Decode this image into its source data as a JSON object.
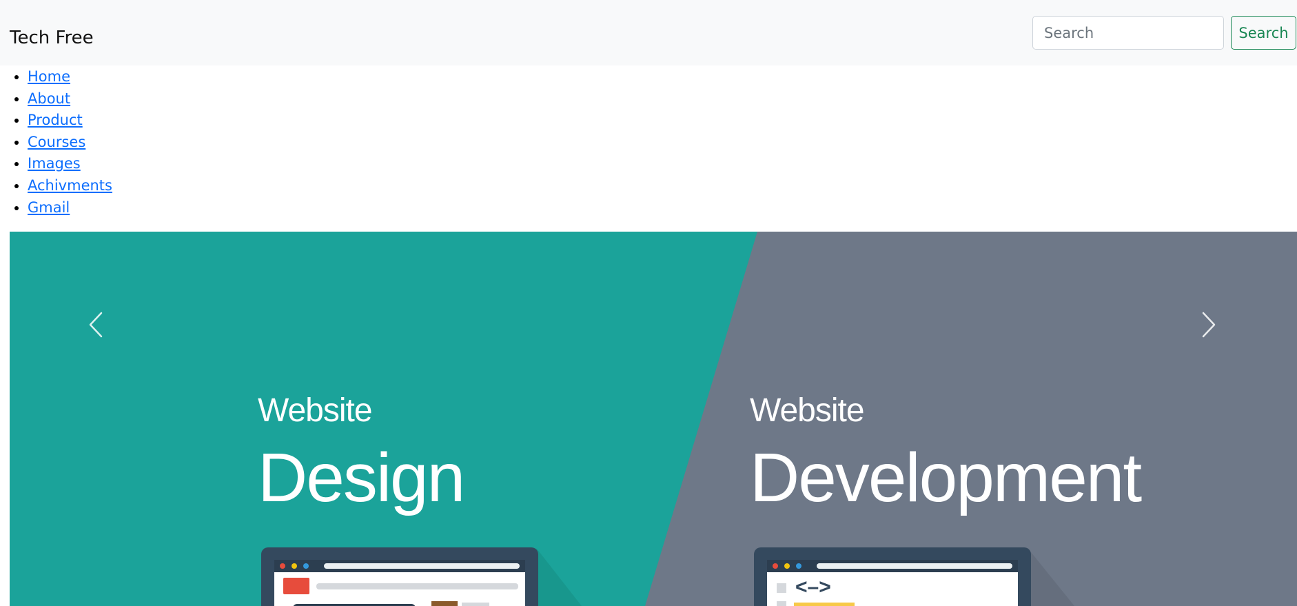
{
  "navbar": {
    "brand": "Tech Free",
    "search_placeholder": "Search",
    "search_button_label": "Search"
  },
  "nav_links": [
    {
      "label": "Home"
    },
    {
      "label": "About"
    },
    {
      "label": "Product"
    },
    {
      "label": "Courses"
    },
    {
      "label": "Images"
    },
    {
      "label": "Achivments"
    },
    {
      "label": "Gmail"
    }
  ],
  "carousel": {
    "slide": {
      "left_small": "Website",
      "left_big": "Design",
      "right_small": "Website",
      "right_big": "Development",
      "code_symbol": "<–>"
    },
    "colors": {
      "teal": "#1ba39a",
      "slate": "#6e7888",
      "laptop_frame": "#34495e"
    },
    "prev_icon": "chevron-left-icon",
    "next_icon": "chevron-right-icon"
  }
}
